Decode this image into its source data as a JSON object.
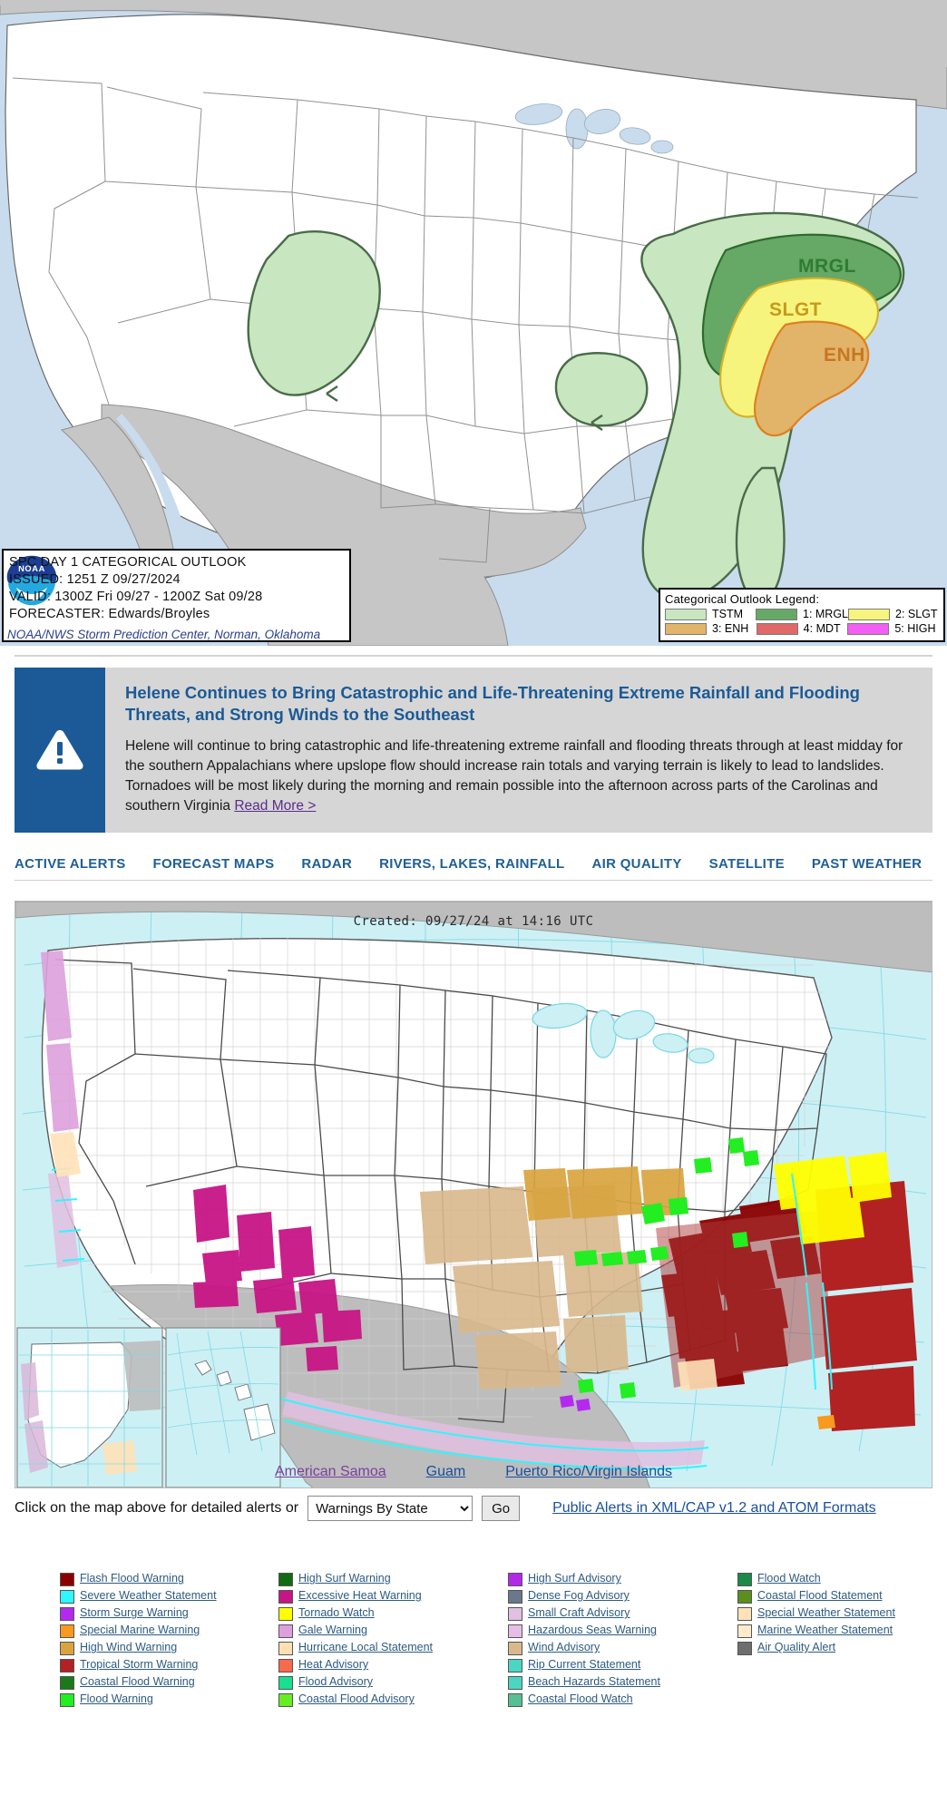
{
  "spc_outlook": {
    "title": "SPC DAY 1 CATEGORICAL OUTLOOK",
    "issued": "ISSUED: 1251 Z 09/27/2024",
    "valid": "VALID: 1300Z Fri 09/27 - 1200Z Sat 09/28",
    "forecaster": "FORECASTER: Edwards/Broyles",
    "credit": "NOAA/NWS Storm Prediction Center, Norman, Oklahoma",
    "logo_alt": "noaa-logo",
    "legend_title": "Categorical Outlook Legend:",
    "legend": [
      {
        "label": "TSTM",
        "color": "#c8e6c0"
      },
      {
        "label": "1: MRGL",
        "color": "#66a866"
      },
      {
        "label": "2: SLGT",
        "color": "#f7f47e"
      },
      {
        "label": "3: ENH",
        "color": "#e2b469"
      },
      {
        "label": "4: MDT",
        "color": "#e06868"
      },
      {
        "label": "5: HIGH",
        "color": "#f35ef3"
      }
    ],
    "risk_labels": [
      {
        "text": "MRGL",
        "color": "#2e7d32"
      },
      {
        "text": "SLGT",
        "color": "#c79a1a"
      },
      {
        "text": "ENH",
        "color": "#c8761f"
      }
    ]
  },
  "alert_banner": {
    "icon": "warning-triangle-icon",
    "title": "Helene Continues to Bring Catastrophic and Life-Threatening Extreme Rainfall and Flooding Threats, and Strong Winds to the Southeast",
    "body": "Helene will continue to bring catastrophic and life-threatening extreme rainfall and flooding threats through at least midday for the southern Appalachians where upslope flow should increase rain totals and varying terrain is likely to lead to landslides. Tornadoes will be most likely during the morning and remain possible into the afternoon across parts of the Carolinas and southern Virginia ",
    "read_more": "Read More >"
  },
  "nav": {
    "tabs": [
      {
        "label": "ACTIVE ALERTS"
      },
      {
        "label": "FORECAST MAPS"
      },
      {
        "label": "RADAR"
      },
      {
        "label": "RIVERS, LAKES, RAINFALL"
      },
      {
        "label": "AIR QUALITY"
      },
      {
        "label": "SATELLITE"
      },
      {
        "label": "PAST WEATHER"
      }
    ]
  },
  "alerts_map": {
    "created": "Created: 09/27/24 at 14:16 UTC",
    "territories": [
      {
        "label": "American Samoa",
        "visited": true
      },
      {
        "label": "Guam",
        "visited": false
      },
      {
        "label": "Puerto Rico/Virgin Islands",
        "visited": false
      }
    ]
  },
  "controls": {
    "instruction": "Click on the map above for detailed alerts or",
    "select_value": "Warnings By State",
    "select_options": [
      "Warnings By State"
    ],
    "go_label": "Go",
    "xml_link": "Public Alerts in XML/CAP v1.2 and ATOM Formats"
  },
  "legend_columns": [
    [
      {
        "label": "Flash Flood Warning",
        "color": "#8b0000"
      },
      {
        "label": "Severe Weather Statement",
        "color": "#2ff6ff"
      },
      {
        "label": "Storm Surge Warning",
        "color": "#b429f0"
      },
      {
        "label": "Special Marine Warning",
        "color": "#f79a1e"
      },
      {
        "label": "High Wind Warning",
        "color": "#d9a440"
      },
      {
        "label": "Tropical Storm Warning",
        "color": "#b22222"
      },
      {
        "label": "Coastal Flood Warning",
        "color": "#1a7a1a"
      },
      {
        "label": "Flood Warning",
        "color": "#22ee22"
      }
    ],
    [
      {
        "label": "High Surf Warning",
        "color": "#126b12"
      },
      {
        "label": "Excessive Heat Warning",
        "color": "#c71585"
      },
      {
        "label": "Tornado Watch",
        "color": "#ffff00"
      },
      {
        "label": "Gale Warning",
        "color": "#dda0dd"
      },
      {
        "label": "Hurricane Local Statement",
        "color": "#ffe0b5"
      },
      {
        "label": "Heat Advisory",
        "color": "#f96a4a"
      },
      {
        "label": "Flood Advisory",
        "color": "#17e08f"
      },
      {
        "label": "Coastal Flood Advisory",
        "color": "#66ee22"
      }
    ],
    [
      {
        "label": "High Surf Advisory",
        "color": "#b429e8"
      },
      {
        "label": "Dense Fog Advisory",
        "color": "#69788a"
      },
      {
        "label": "Small Craft Advisory",
        "color": "#e1c0e1"
      },
      {
        "label": "Hazardous Seas Warning",
        "color": "#e6bde6"
      },
      {
        "label": "Wind Advisory",
        "color": "#d9b88c"
      },
      {
        "label": "Rip Current Statement",
        "color": "#4bd6c4"
      },
      {
        "label": "Beach Hazards Statement",
        "color": "#4bd6c4"
      },
      {
        "label": "Coastal Flood Watch",
        "color": "#56bf94"
      }
    ],
    [
      {
        "label": "Flood Watch",
        "color": "#1a8a4a"
      },
      {
        "label": "Coastal Flood Statement",
        "color": "#5a8f1e"
      },
      {
        "label": "Special Weather Statement",
        "color": "#ffe2b8"
      },
      {
        "label": "Marine Weather Statement",
        "color": "#ffeacc"
      },
      {
        "label": "Air Quality Alert",
        "color": "#6e6e6e"
      }
    ]
  ]
}
